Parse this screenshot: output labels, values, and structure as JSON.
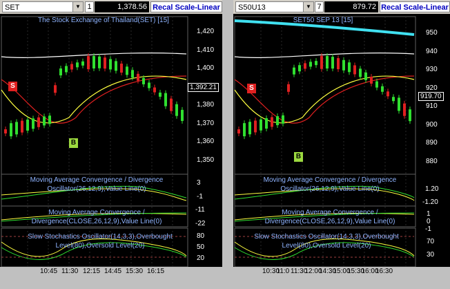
{
  "left": {
    "symbol": "SET",
    "period": "1",
    "last_price": "1,378.56",
    "recal_label": "Recal Scale-Linear",
    "chart_title": "The Stock Exchange of Thailand(SET) [15]",
    "price_tag": "1,392.21",
    "y_ticks": [
      "1,420",
      "1,410",
      "1,400",
      "1,390",
      "1,380",
      "1,370",
      "1,360",
      "1,350"
    ],
    "osc1_label_line1": "Moving Average Convergence / Divergence",
    "osc1_label_line2": "Oscillator(26,12,9),Value Line(0)",
    "osc1_ticks": [
      "3",
      "-1"
    ],
    "osc2_label_line1": "Moving Average Convergence /",
    "osc2_label_line2": "Divergence(CLOSE,26,12,9),Value Line(0)",
    "osc2_ticks": [
      "-11",
      "-22"
    ],
    "osc3_label_line1": "Slow Stochastics Oscillator(14,3,3),Overbought",
    "osc3_label_line2": "Level(80),Oversold Level(20)",
    "osc3_ticks": [
      "80",
      "50",
      "20"
    ],
    "time_labels": [
      "10:45",
      "11:30",
      "12:15",
      "14:45",
      "15:30",
      "16:15"
    ],
    "sell_marker": "S",
    "buy_marker": "B"
  },
  "right": {
    "symbol": "S50U13",
    "period": "7",
    "last_price": "879.72",
    "recal_label": "Recal Scale-Linear",
    "chart_title": "SET50 SEP 13  [15]",
    "price_tag": "919.70",
    "y_ticks": [
      "950",
      "940",
      "930",
      "920",
      "910",
      "900",
      "890",
      "880"
    ],
    "osc1_label_line1": "Moving Average Convergence / Divergence",
    "osc1_label_line2": "Oscillator(26,12,9),Value Line(0)",
    "osc1_ticks": [
      "1.20",
      "-1.20"
    ],
    "osc2_label_line1": "Moving Average Convergence /",
    "osc2_label_line2": "Divergence(CLOSE,26,12,9),Value Line(0)",
    "osc2_ticks": [
      "1",
      "0",
      "-1"
    ],
    "osc3_label_line1": "Slow Stochastics Oscillator(14,3,3),Overbought",
    "osc3_label_line2": "Level(80),Oversold Level(20)",
    "osc3_ticks": [
      "70",
      "30"
    ],
    "time_labels": [
      "10:30",
      "11:0",
      "11:30",
      "12:00",
      "14:30",
      "15:00",
      "15:30",
      "16:00",
      "16:30"
    ],
    "sell_marker": "S",
    "buy_marker": "B"
  },
  "colors": {
    "up_candle": "#30e030",
    "down_candle": "#e02020",
    "ma_fast": "#ffff40",
    "ma_slow": "#e02020",
    "ma_long": "#ffffff",
    "cyan_band": "#40e0f0",
    "osc_line": "#ffff40",
    "signal_line": "#30e030",
    "grid": "#2a2a2a"
  }
}
